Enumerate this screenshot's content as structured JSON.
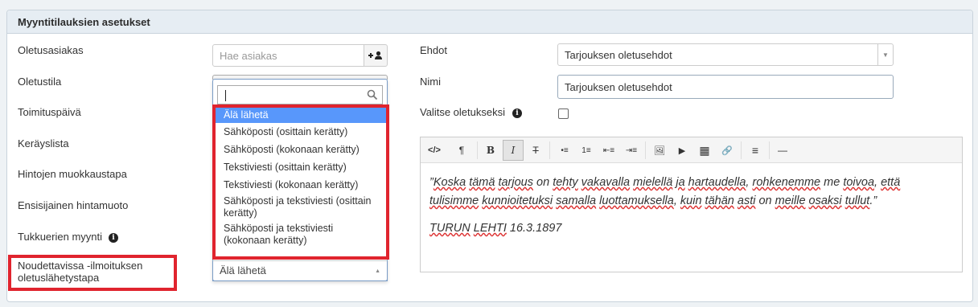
{
  "panel": {
    "title": "Myyntitilauksien asetukset"
  },
  "left_labels": {
    "default_customer": "Oletusasiakas",
    "default_status": "Oletustila",
    "delivery_date": "Toimituspäivä",
    "picking_list": "Keräyslista",
    "price_edit_mode": "Hintojen muokkaustapa",
    "primary_price_format": "Ensisijainen hintamuoto",
    "wholesale_sales": "Tukkuerien myynti",
    "pickup_notice_line1": "Noudettavissa -ilmoituksen",
    "pickup_notice_line2": "oletuslähetystapa"
  },
  "customer_search": {
    "placeholder": "Hae asiakas",
    "add_button": "+👤"
  },
  "dropdown": {
    "search_value": "",
    "options": [
      "Älä lähetä",
      "Sähköposti (osittain kerätty)",
      "Sähköposti (kokonaan kerätty)",
      "Tekstiviesti (osittain kerätty)",
      "Tekstiviesti (kokonaan kerätty)",
      "Sähköposti ja tekstiviesti (osittain kerätty)",
      "Sähköposti ja tekstiviesti (kokonaan kerätty)"
    ],
    "selected_value": "Älä lähetä"
  },
  "right": {
    "terms_label": "Ehdot",
    "terms_value": "Tarjouksen oletusehdot",
    "name_label": "Nimi",
    "name_value": "Tarjouksen oletusehdot",
    "default_label": "Valitse oletukseksi"
  },
  "editor": {
    "toolbar": [
      "</>",
      "¶",
      "B",
      "I",
      "T",
      "•≡",
      "1≡",
      "⇤≡",
      "⇥≡",
      "🖼",
      "▶",
      "▦",
      "🔗",
      "≡",
      "—"
    ],
    "quote_parts": {
      "open": "”",
      "w1": "Koska",
      "t1": " ",
      "w2": "tämä",
      "t2": " ",
      "w3": "tarjous",
      "t3": " on ",
      "w4": "tehty",
      "t4": " ",
      "w5": "vakavalla",
      "t5": " ",
      "w6": "mielellä",
      "t6": " ",
      "w7": "ja",
      "t7": " ",
      "w8": "hartaudella",
      "t8": ", ",
      "w9": "rohkenemme",
      "t9": " me ",
      "w10": "toivoa",
      "t10": ", ",
      "w11": "että",
      "w12": "tulisimme",
      "t12": " ",
      "w13": "kunnioitetuksi",
      "t13": " ",
      "w14": "samalla",
      "t14": " ",
      "w15": "luottamuksella",
      "t15": ", ",
      "w16": "kuin",
      "t16": " ",
      "w17": "tähän",
      "t17": " ",
      "w18": "asti",
      "t18": " on ",
      "w19": "meille",
      "t19": " ",
      "w20": "osaksi",
      "t20": " ",
      "w21": "tullut",
      "close": ".”"
    },
    "source_words": {
      "s1": "TURUN",
      "s2": "LEHTI",
      "date": " 16.3.1897"
    }
  },
  "colors": {
    "highlight": "#5897fb",
    "annotation_red": "#e0242e"
  }
}
